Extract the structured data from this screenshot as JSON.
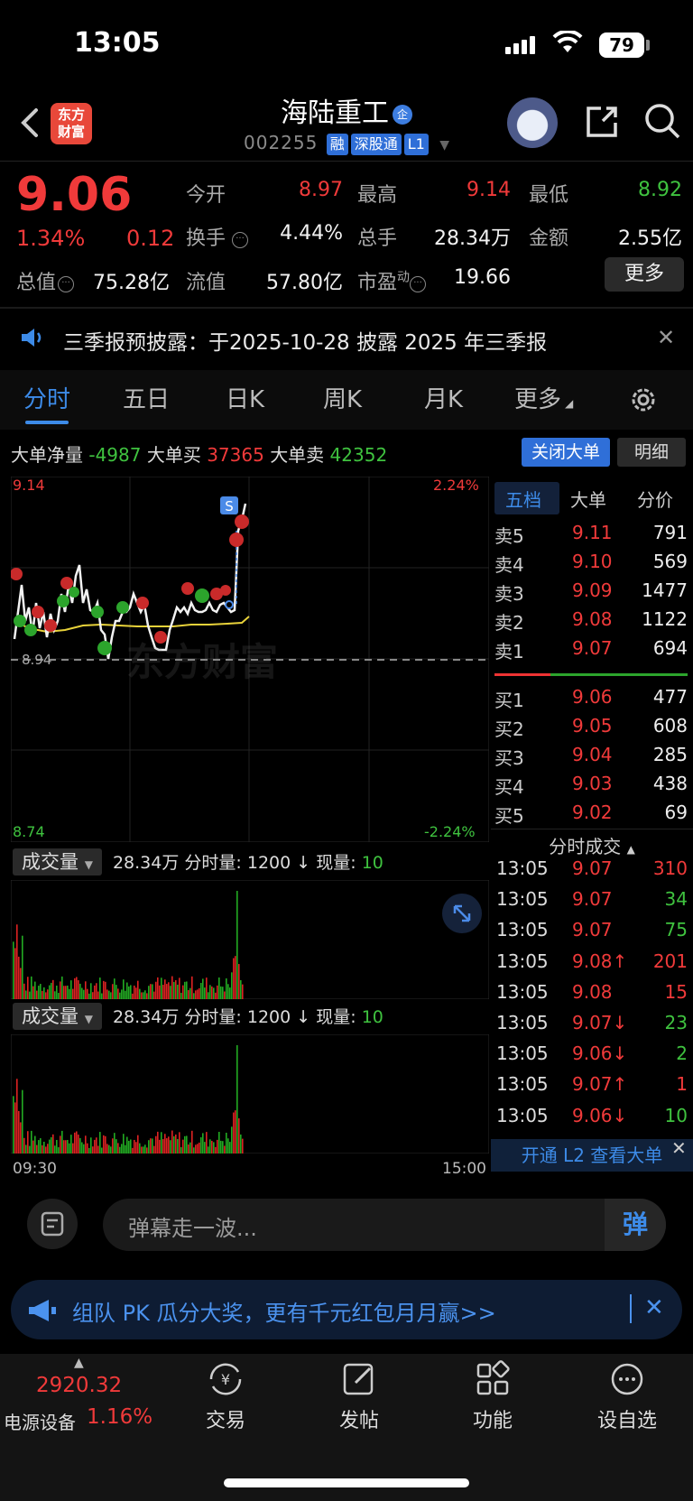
{
  "status_bar": {
    "time": "13:05",
    "battery": "79"
  },
  "header": {
    "logo_line1": "东方",
    "logo_line2": "财富",
    "stock_name": "海陆重工",
    "name_tag": "企",
    "code": "002255",
    "badges": [
      "融",
      "深股通",
      "L1"
    ]
  },
  "quote": {
    "price": "9.06",
    "change_pct": "1.34%",
    "change": "0.12",
    "open_label": "今开",
    "open": "8.97",
    "high_label": "最高",
    "high": "9.14",
    "low_label": "最低",
    "low": "8.92",
    "turnover_label": "换手",
    "turnover": "4.44%",
    "volume_label": "总手",
    "volume": "28.34万",
    "amount_label": "金额",
    "amount": "2.55亿",
    "mktcap_label": "总值",
    "mktcap": "75.28亿",
    "float_label": "流值",
    "float": "57.80亿",
    "pe_label": "市盈",
    "pe_sup": "动",
    "pe": "19.66",
    "more_label": "更多"
  },
  "notice": {
    "text": "三季报预披露：于2025-10-28 披露 2025 年三季报"
  },
  "tabs": [
    "分时",
    "五日",
    "日K",
    "周K",
    "月K",
    "更多"
  ],
  "big_order": {
    "net_label": "大单净量",
    "net": "-4987",
    "buy_label": "大单买",
    "buy": "37365",
    "sell_label": "大单卖",
    "sell": "42352",
    "close_btn": "关闭大单",
    "detail_btn": "明细"
  },
  "chart": {
    "hi": "9.14",
    "lo": "8.74",
    "hi_pct": "2.24%",
    "lo_pct": "-2.24%",
    "mid_label": "8.94",
    "watermark": "东方财富",
    "signal_label": "S"
  },
  "volume_panels": [
    {
      "selector": "成交量",
      "total": "28.34万",
      "fs_label": "分时量:",
      "fs": "1200",
      "now_label": "现量:",
      "now": "10",
      "max": "20876"
    },
    {
      "selector": "成交量",
      "total": "28.34万",
      "fs_label": "分时量:",
      "fs": "1200",
      "now_label": "现量:",
      "now": "10",
      "max": "20876"
    }
  ],
  "time_axis": {
    "start": "09:30",
    "end": "15:00"
  },
  "order_book": {
    "tabs": [
      "五档",
      "大单",
      "分价"
    ],
    "asks": [
      {
        "label": "卖5",
        "price": "9.11",
        "vol": "791"
      },
      {
        "label": "卖4",
        "price": "9.10",
        "vol": "569"
      },
      {
        "label": "卖3",
        "price": "9.09",
        "vol": "1477"
      },
      {
        "label": "卖2",
        "price": "9.08",
        "vol": "1122"
      },
      {
        "label": "卖1",
        "price": "9.07",
        "vol": "694"
      }
    ],
    "bids": [
      {
        "label": "买1",
        "price": "9.06",
        "vol": "477"
      },
      {
        "label": "买2",
        "price": "9.05",
        "vol": "608"
      },
      {
        "label": "买3",
        "price": "9.04",
        "vol": "285"
      },
      {
        "label": "买4",
        "price": "9.03",
        "vol": "438"
      },
      {
        "label": "买5",
        "price": "9.02",
        "vol": "69"
      }
    ],
    "ticks_title": "分时成交",
    "ticks": [
      {
        "time": "13:05",
        "price": "9.07",
        "vol": "310",
        "dir": "buy"
      },
      {
        "time": "13:05",
        "price": "9.07",
        "vol": "34",
        "dir": "sell"
      },
      {
        "time": "13:05",
        "price": "9.07",
        "vol": "75",
        "dir": "sell"
      },
      {
        "time": "13:05",
        "price": "9.08↑",
        "vol": "201",
        "dir": "buy"
      },
      {
        "time": "13:05",
        "price": "9.08",
        "vol": "15",
        "dir": "buy"
      },
      {
        "time": "13:05",
        "price": "9.07↓",
        "vol": "23",
        "dir": "sell"
      },
      {
        "time": "13:05",
        "price": "9.06↓",
        "vol": "2",
        "dir": "sell"
      },
      {
        "time": "13:05",
        "price": "9.07↑",
        "vol": "1",
        "dir": "buy"
      },
      {
        "time": "13:05",
        "price": "9.06↓",
        "vol": "10",
        "dir": "sell"
      }
    ],
    "l2_text": "开通 L2 查看大单"
  },
  "comment": {
    "placeholder": "弹幕走一波...",
    "danmu_label": "弹"
  },
  "promo": {
    "text": "组队 PK 瓜分大奖，更有千元红包月月赢>>"
  },
  "bottom_nav": {
    "index_value": "2920.32",
    "index_name": "电源设备",
    "index_pct": "1.16%",
    "items": [
      "交易",
      "发帖",
      "功能",
      "设自选"
    ]
  },
  "colors": {
    "up": "#f03a3a",
    "down": "#3fc23f",
    "accent": "#3d8be8",
    "avg_line": "#e8d23a"
  }
}
